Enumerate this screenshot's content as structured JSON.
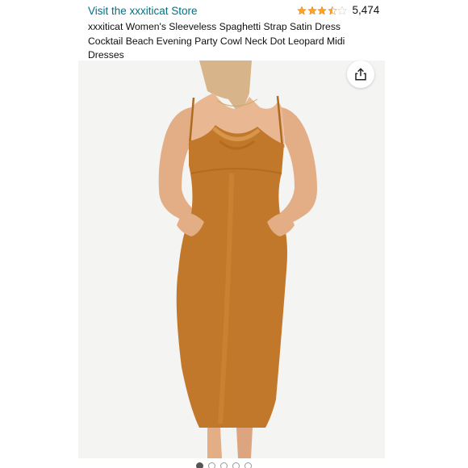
{
  "store": {
    "link_text": "Visit the xxxiticat Store"
  },
  "rating": {
    "stars": 3.5,
    "out_of": 5,
    "count": "5,474"
  },
  "product": {
    "title": "xxxiticat Women's Sleeveless Spaghetti Strap Satin Dress Cocktail Beach Evening Party Cowl Neck Dot Leopard Midi Dresses"
  },
  "share": {
    "icon": "share-icon"
  },
  "carousel": {
    "total": 5,
    "active_index": 0
  },
  "colors": {
    "link": "#007185",
    "star_fill": "#ffa41c",
    "dress": "#c2782a"
  }
}
